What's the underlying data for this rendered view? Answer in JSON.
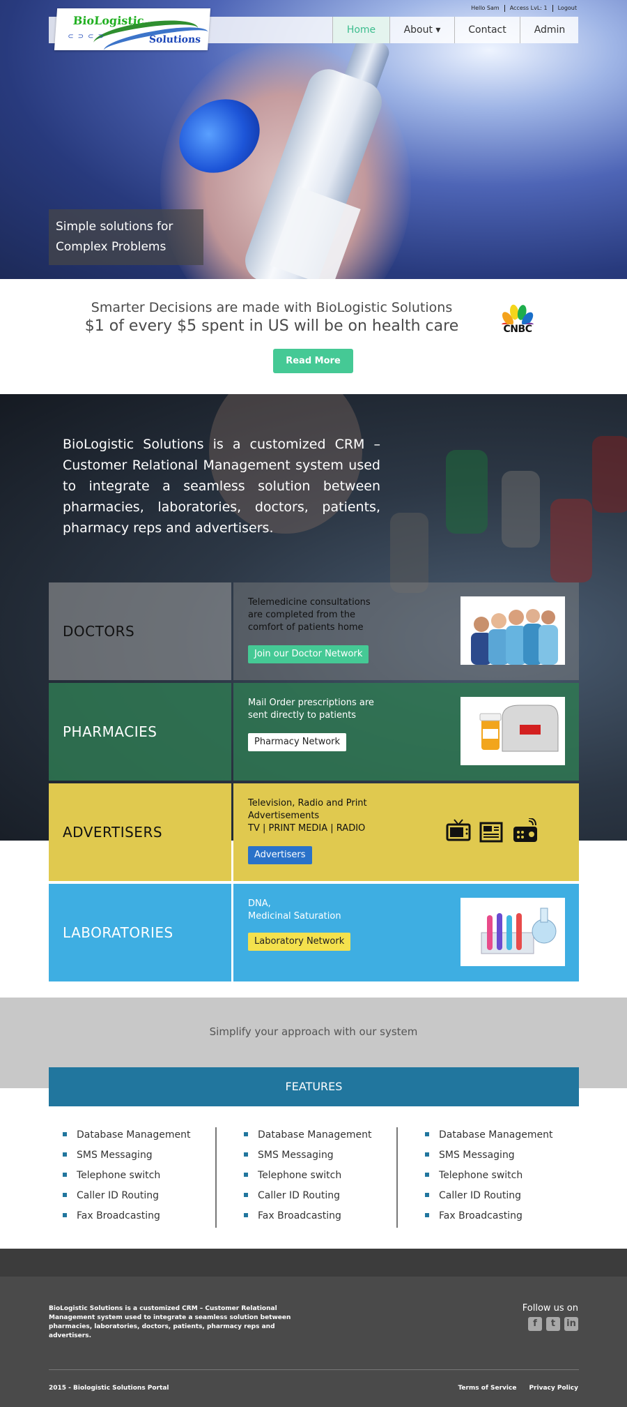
{
  "header": {
    "user_greeting": "Hello Sam",
    "access_level": "Access LvL: 1",
    "logout": "Logout",
    "logo_line1": "BioLogistic",
    "logo_line2": "Solutions",
    "nav": [
      "Home",
      "About ▾",
      "Contact",
      "Admin"
    ],
    "active_nav": "Home"
  },
  "hero": {
    "tagline_line1": "Simple solutions for",
    "tagline_line2": "Complex Problems"
  },
  "promo": {
    "line1": "Smarter Decisions are made with BioLogistic Solutions",
    "line2": "$1 of every $5 spent in US will be on health care",
    "button": "Read More",
    "brand_logo": "CNBC"
  },
  "intro": {
    "text": "BioLogistic Solutions is a customized CRM – Customer Relational Management system used to integrate a seamless solution between pharmacies, laboratories, doctors, patients, pharmacy reps and advertisers."
  },
  "categories": {
    "doctors": {
      "label": "DOCTORS",
      "desc": "Telemedicine consultations are completed from the comfort of patients home",
      "button": "Join our Doctor Network",
      "image": "medical-staff-photo"
    },
    "pharmacies": {
      "label": "PHARMACIES",
      "desc": "Mail Order prescriptions are sent directly to patients",
      "button": "Pharmacy Network",
      "image": "mailbox-pills-photo"
    },
    "advertisers": {
      "label": "ADVERTISERS",
      "desc_line1": "Television, Radio and Print Advertisements",
      "desc_line2": "TV | PRINT MEDIA | RADIO",
      "button": "Advertisers",
      "icons": [
        "tv-icon",
        "newspaper-icon",
        "radio-icon"
      ]
    },
    "laboratories": {
      "label": "LABORATORIES",
      "desc_line1": "DNA,",
      "desc_line2": "Medicinal Saturation",
      "button": "Laboratory Network",
      "image": "lab-tubes-photo"
    }
  },
  "simplify": {
    "text": "Simplify your approach with our system"
  },
  "features": {
    "heading": "FEATURES",
    "columns": [
      [
        "Database Management",
        "SMS Messaging",
        "Telephone switch",
        "Caller ID Routing",
        "Fax Broadcasting"
      ],
      [
        "Database Management",
        "SMS Messaging",
        "Telephone switch",
        "Caller ID Routing",
        "Fax Broadcasting"
      ],
      [
        "Database Management",
        "SMS Messaging",
        "Telephone switch",
        "Caller ID Routing",
        "Fax Broadcasting"
      ]
    ]
  },
  "footer": {
    "about": "BioLogistic Solutions is a customized CRM – Customer Relational Management system used to integrate a seamless solution between pharmacies, laboratories, doctors, patients, pharmacy reps and advertisers.",
    "follow": "Follow us on",
    "socials": [
      "facebook-icon",
      "twitter-icon",
      "linkedin-icon"
    ],
    "copyright": "2015 - Biologistic Solutions Portal",
    "links": [
      "Terms of Service",
      "Privacy Policy"
    ]
  },
  "colors": {
    "accent_green": "#45c995",
    "pharmacy_green": "#2f7852",
    "advertiser_yellow": "#e0c94f",
    "lab_blue": "#3eaee2",
    "features_blue": "#21769e",
    "footer_gray": "#4a4a4a"
  }
}
